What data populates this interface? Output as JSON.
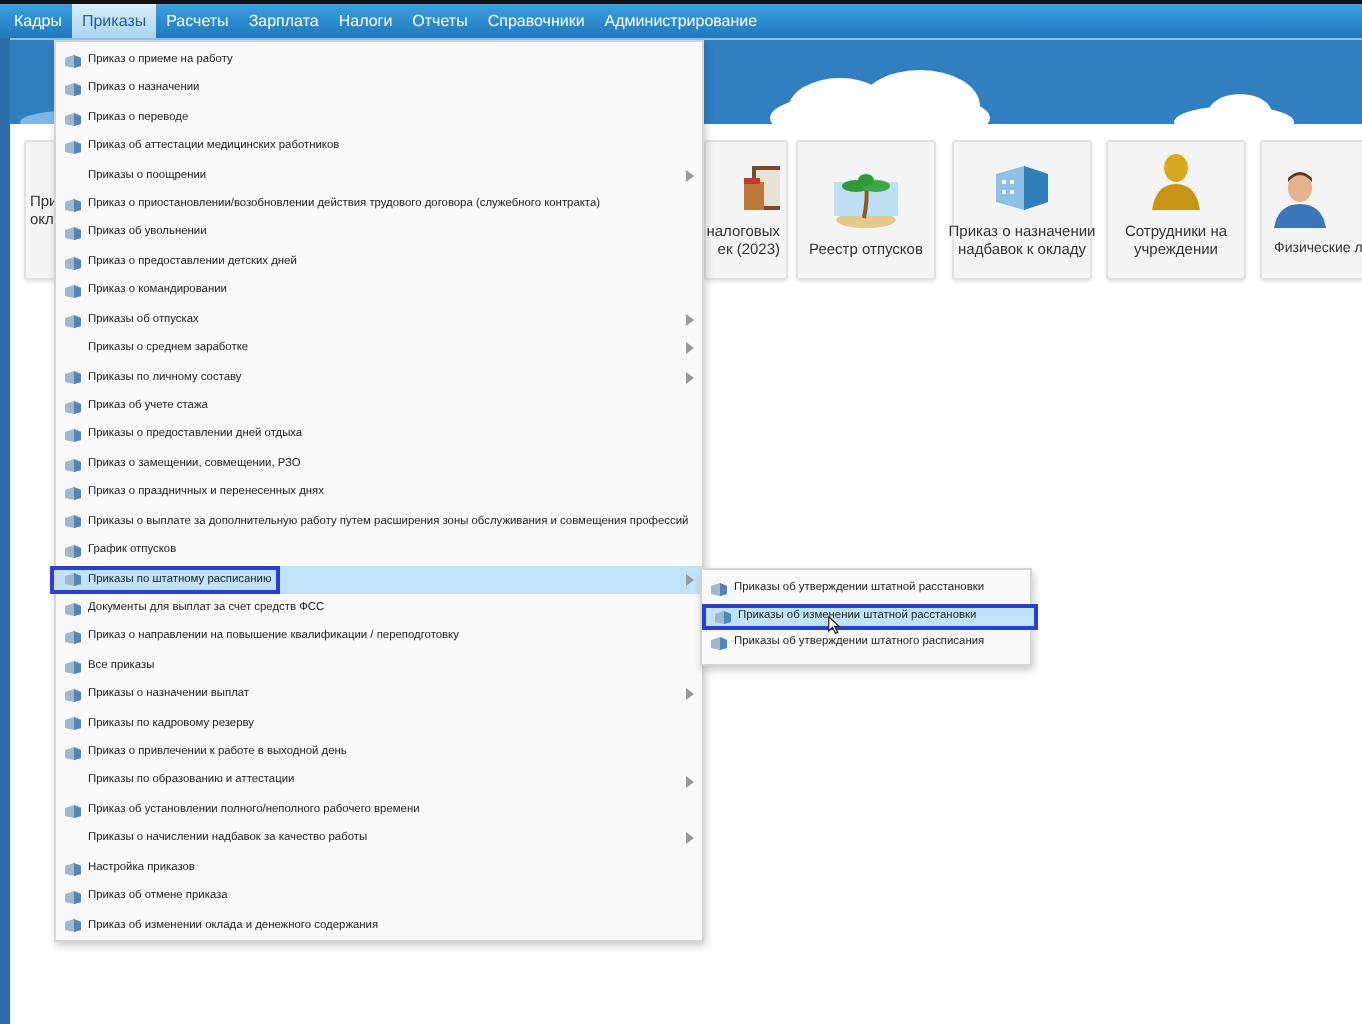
{
  "nav": [
    {
      "label": "Кадры",
      "selected": false
    },
    {
      "label": "Приказы",
      "selected": true
    },
    {
      "label": "Расчеты",
      "selected": false
    },
    {
      "label": "Зарплата",
      "selected": false
    },
    {
      "label": "Налоги",
      "selected": false
    },
    {
      "label": "Отчеты",
      "selected": false
    },
    {
      "label": "Справочники",
      "selected": false
    },
    {
      "label": "Администрирование",
      "selected": false
    }
  ],
  "tiles": [
    {
      "kind": "hidden",
      "lines": [
        "При",
        "окл"
      ]
    },
    {
      "kind": "book",
      "lines": [
        "налоговых",
        "ек (2023)"
      ]
    },
    {
      "kind": "palm",
      "lines": [
        "Реестр отпусков"
      ]
    },
    {
      "kind": "building",
      "lines": [
        "Приказ о назначении",
        "надбавок к окладу"
      ]
    },
    {
      "kind": "officer",
      "lines": [
        "Сотрудники на",
        "учреждении"
      ]
    },
    {
      "kind": "person",
      "lines": [
        "Физические л"
      ]
    }
  ],
  "menu": [
    {
      "label": "Приказ о приеме на работу",
      "icon": true,
      "submenu": false,
      "selected": false,
      "outlined": false
    },
    {
      "label": "Приказ о назначении",
      "icon": true,
      "submenu": false,
      "selected": false,
      "outlined": false
    },
    {
      "label": "Приказ о переводе",
      "icon": true,
      "submenu": false,
      "selected": false,
      "outlined": false
    },
    {
      "label": "Приказ об аттестации медицинских работников",
      "icon": true,
      "submenu": false,
      "selected": false,
      "outlined": false
    },
    {
      "label": "Приказы о поощрении",
      "icon": false,
      "submenu": true,
      "selected": false,
      "outlined": false
    },
    {
      "label": "Приказ о приостановлении/возобновлении действия трудового договора (служебного контракта)",
      "icon": true,
      "submenu": false,
      "selected": false,
      "outlined": false
    },
    {
      "label": "Приказ об увольнении",
      "icon": true,
      "submenu": false,
      "selected": false,
      "outlined": false
    },
    {
      "label": "Приказ о предоставлении детских дней",
      "icon": true,
      "submenu": false,
      "selected": false,
      "outlined": false
    },
    {
      "label": "Приказ о командировании",
      "icon": true,
      "submenu": false,
      "selected": false,
      "outlined": false
    },
    {
      "label": "Приказы об отпусках",
      "icon": true,
      "submenu": true,
      "selected": false,
      "outlined": false
    },
    {
      "label": "Приказы о среднем заработке",
      "icon": false,
      "submenu": true,
      "selected": false,
      "outlined": false
    },
    {
      "label": "Приказы по личному составу",
      "icon": true,
      "submenu": true,
      "selected": false,
      "outlined": false
    },
    {
      "label": "Приказ об учете стажа",
      "icon": true,
      "submenu": false,
      "selected": false,
      "outlined": false
    },
    {
      "label": "Приказы о предоставлении дней отдыха",
      "icon": true,
      "submenu": false,
      "selected": false,
      "outlined": false
    },
    {
      "label": "Приказ о замещении, совмещении, РЗО",
      "icon": true,
      "submenu": false,
      "selected": false,
      "outlined": false
    },
    {
      "label": "Приказ о праздничных и перенесенных днях",
      "icon": true,
      "submenu": false,
      "selected": false,
      "outlined": false
    },
    {
      "label": "Приказы о выплате за дополнительную работу путем расширения зоны обслуживания и совмещения профессий",
      "icon": true,
      "submenu": false,
      "selected": false,
      "outlined": false
    },
    {
      "label": "График отпусков",
      "icon": true,
      "submenu": false,
      "selected": false,
      "outlined": false
    },
    {
      "label": "Приказы по штатному расписанию",
      "icon": true,
      "submenu": true,
      "selected": true,
      "outlined": true
    },
    {
      "label": "Документы для выплат за счет средств ФСС",
      "icon": true,
      "submenu": false,
      "selected": false,
      "outlined": false
    },
    {
      "label": "Приказ о направлении на повышение квалификации / переподготовку",
      "icon": true,
      "submenu": false,
      "selected": false,
      "outlined": false
    },
    {
      "label": "Все приказы",
      "icon": true,
      "submenu": false,
      "selected": false,
      "outlined": false
    },
    {
      "label": "Приказы о назначении выплат",
      "icon": true,
      "submenu": true,
      "selected": false,
      "outlined": false
    },
    {
      "label": "Приказы по кадровому резерву",
      "icon": true,
      "submenu": false,
      "selected": false,
      "outlined": false
    },
    {
      "label": "Приказ о привлечении к работе в выходной день",
      "icon": true,
      "submenu": false,
      "selected": false,
      "outlined": false
    },
    {
      "label": "Приказы по образованию и аттестации",
      "icon": false,
      "submenu": true,
      "selected": false,
      "outlined": false
    },
    {
      "label": "Приказ об установлении полного/неполного рабочего времени",
      "icon": true,
      "submenu": false,
      "selected": false,
      "outlined": false
    },
    {
      "label": "Приказы о начислении надбавок за качество работы",
      "icon": false,
      "submenu": true,
      "selected": false,
      "outlined": false
    },
    {
      "label": "Настройка приказов",
      "icon": true,
      "submenu": false,
      "selected": false,
      "outlined": false
    },
    {
      "label": "Приказ об отмене приказа",
      "icon": true,
      "submenu": false,
      "selected": false,
      "outlined": false
    },
    {
      "label": "Приказ об изменении оклада и денежного содержания",
      "icon": true,
      "submenu": false,
      "selected": false,
      "outlined": false
    }
  ],
  "submenu": [
    {
      "label": "Приказы об утверждении штатной расстановки",
      "selected": false,
      "outlined": false
    },
    {
      "label": "Приказы об изменении штатной расстановки",
      "selected": true,
      "outlined": true
    },
    {
      "label": "Приказы об утверждении штатного расписания",
      "selected": false,
      "outlined": false
    }
  ]
}
